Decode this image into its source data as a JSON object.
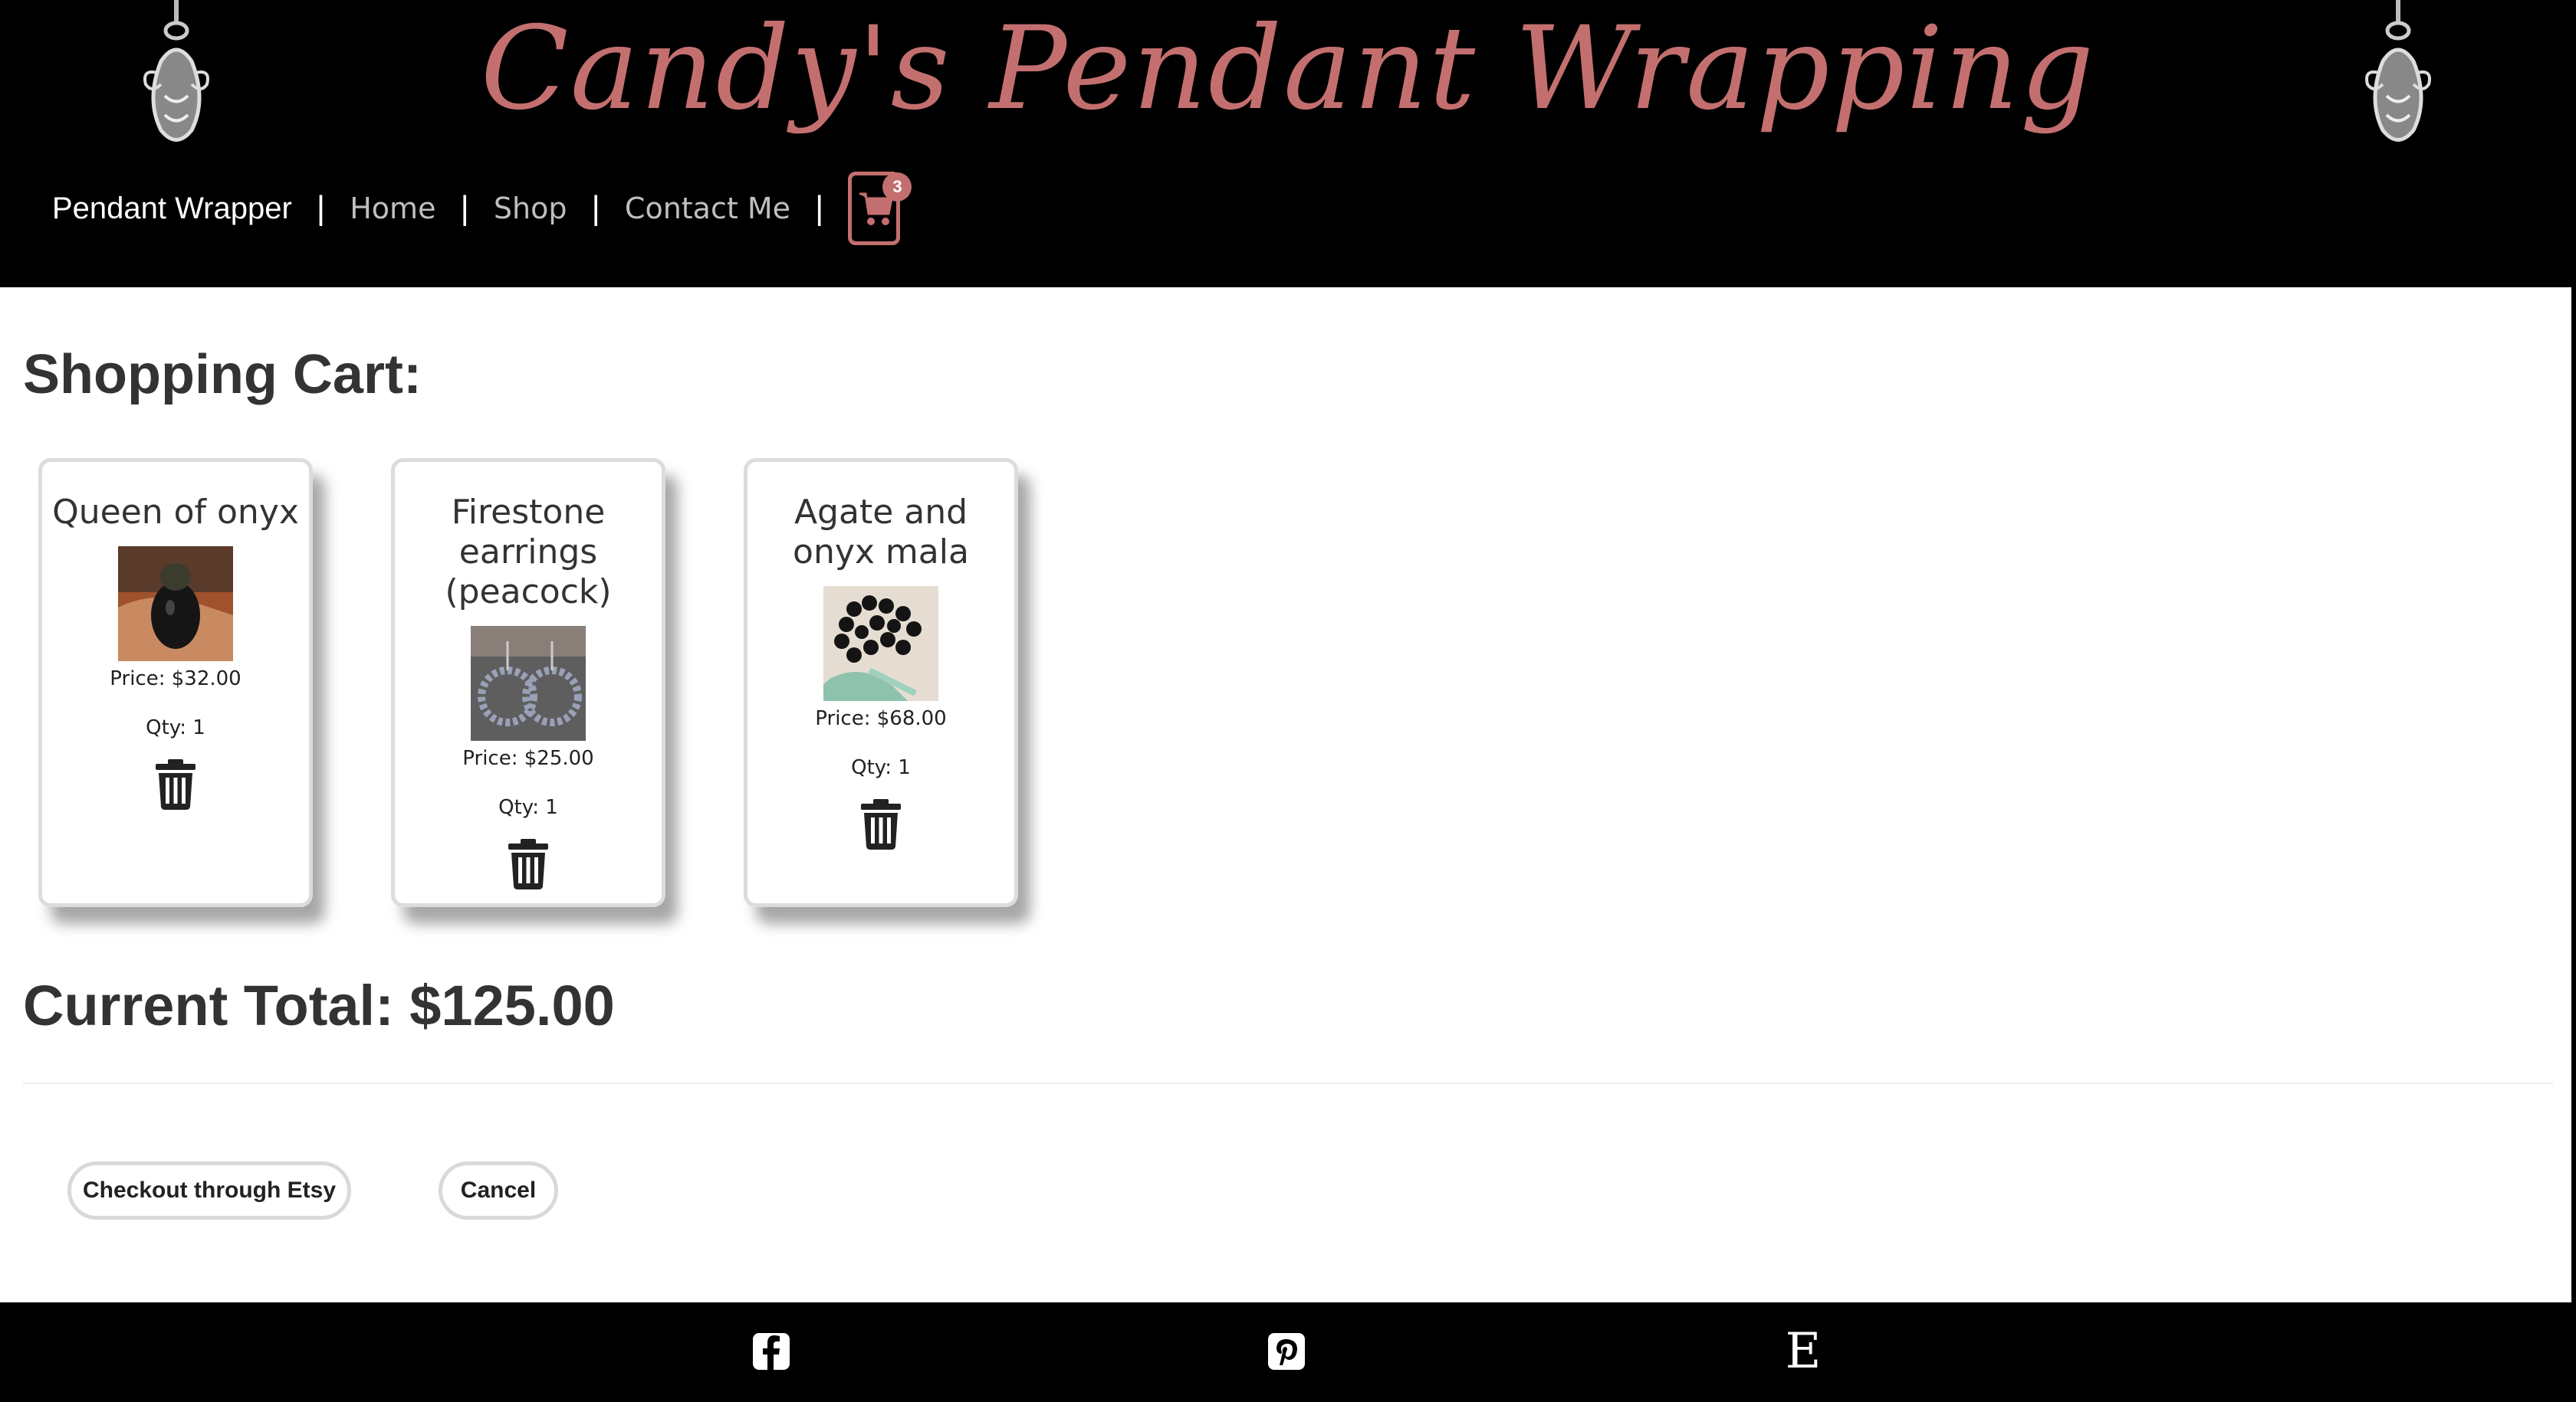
{
  "header": {
    "site_title": "Candy's Pendant Wrapping",
    "brand": "Pendant Wrapper",
    "nav": [
      {
        "label": "Home"
      },
      {
        "label": "Shop"
      },
      {
        "label": "Contact Me"
      }
    ],
    "separator": "|",
    "cart_count": "3",
    "colors": {
      "accent": "#c46f6f",
      "background": "#000000",
      "nav_link": "#bfbfbf"
    }
  },
  "main": {
    "heading": "Shopping Cart:",
    "items": [
      {
        "title": "Queen of onyx",
        "price": "Price: $32.00",
        "qty": "Qty: 1",
        "icon": "trash-icon"
      },
      {
        "title": "Firestone earrings (peacock)",
        "price": "Price: $25.00",
        "qty": "Qty: 1",
        "icon": "trash-icon"
      },
      {
        "title": "Agate and onyx mala",
        "price": "Price: $68.00",
        "qty": "Qty: 1",
        "icon": "trash-icon"
      }
    ],
    "total": "Current Total: $125.00",
    "checkout_label": "Checkout through Etsy",
    "cancel_label": "Cancel"
  },
  "footer": {
    "icons": [
      "facebook-icon",
      "pinterest-icon",
      "etsy-icon"
    ],
    "etsy_glyph": "E"
  }
}
